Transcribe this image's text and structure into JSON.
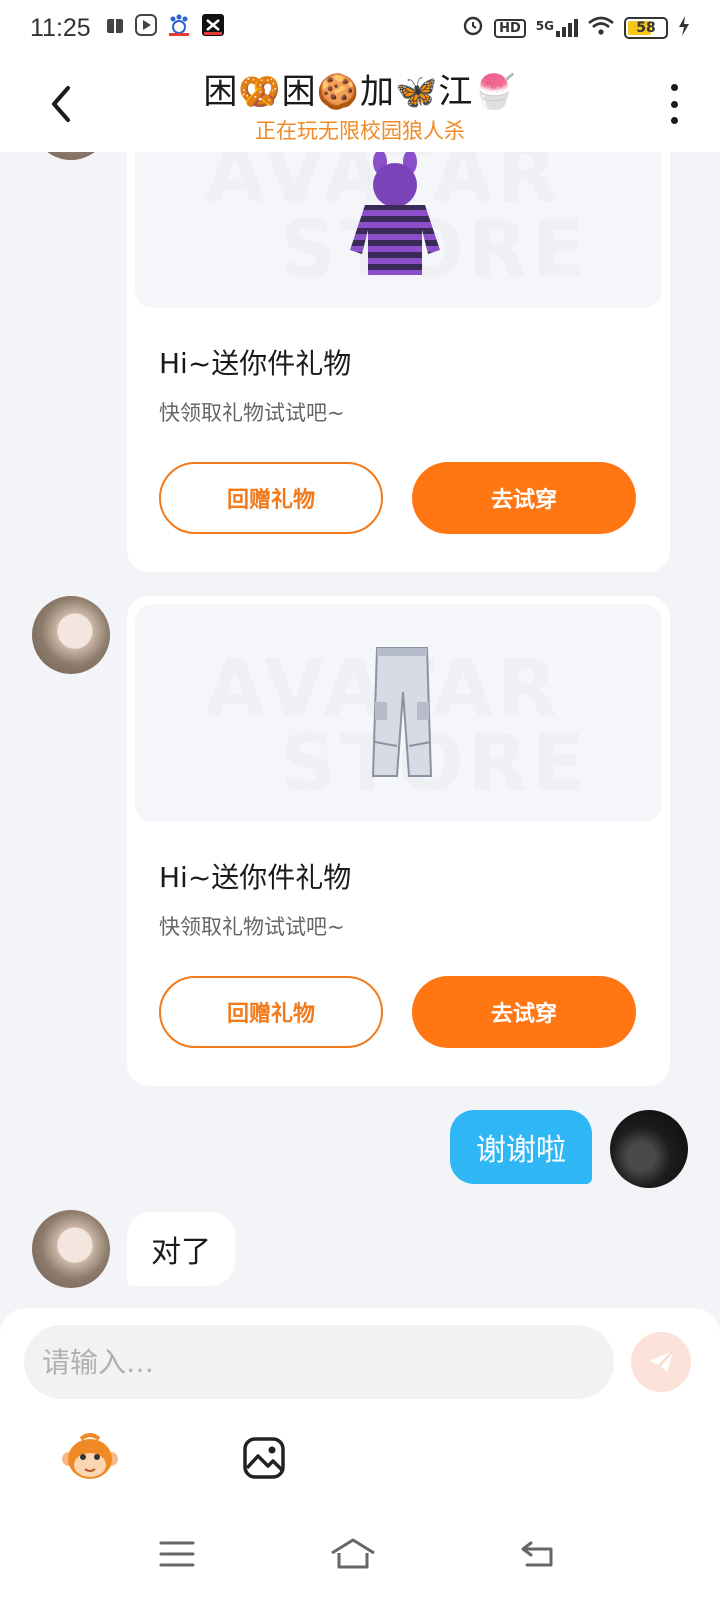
{
  "status_bar": {
    "time": "11:25",
    "signal_label": "5G",
    "hd_label": "HD",
    "battery_level": "58",
    "battery_fraction": 0.58
  },
  "header": {
    "title": "困🥨困🍪加🦋江🍧",
    "subtitle": "正在玩无限校园狼人杀"
  },
  "watermark": {
    "line1": "AVATAR",
    "line2": "STORE"
  },
  "gift_cards": [
    {
      "title": "Hi~送你件礼物",
      "subtitle": "快领取礼物试试吧~",
      "return_gift_label": "回赠礼物",
      "try_on_label": "去试穿",
      "item": "hoodie"
    },
    {
      "title": "Hi~送你件礼物",
      "subtitle": "快领取礼物试试吧~",
      "return_gift_label": "回赠礼物",
      "try_on_label": "去试穿",
      "item": "cargo-pants"
    }
  ],
  "messages": {
    "sent_text": "谢谢啦",
    "received_text": "对了"
  },
  "composer": {
    "placeholder": "请输入…",
    "send_icon": "paper-plane-icon",
    "sticker_icon": "monkey-face-icon",
    "image_icon": "image-icon"
  },
  "nav": {
    "menu_icon": "menu-icon",
    "home_icon": "home-icon",
    "back_icon": "back-arrow-icon"
  },
  "colors": {
    "accent_orange": "#ff7613",
    "bubble_blue": "#2eb6f5",
    "subtitle_orange": "#f08a24"
  }
}
